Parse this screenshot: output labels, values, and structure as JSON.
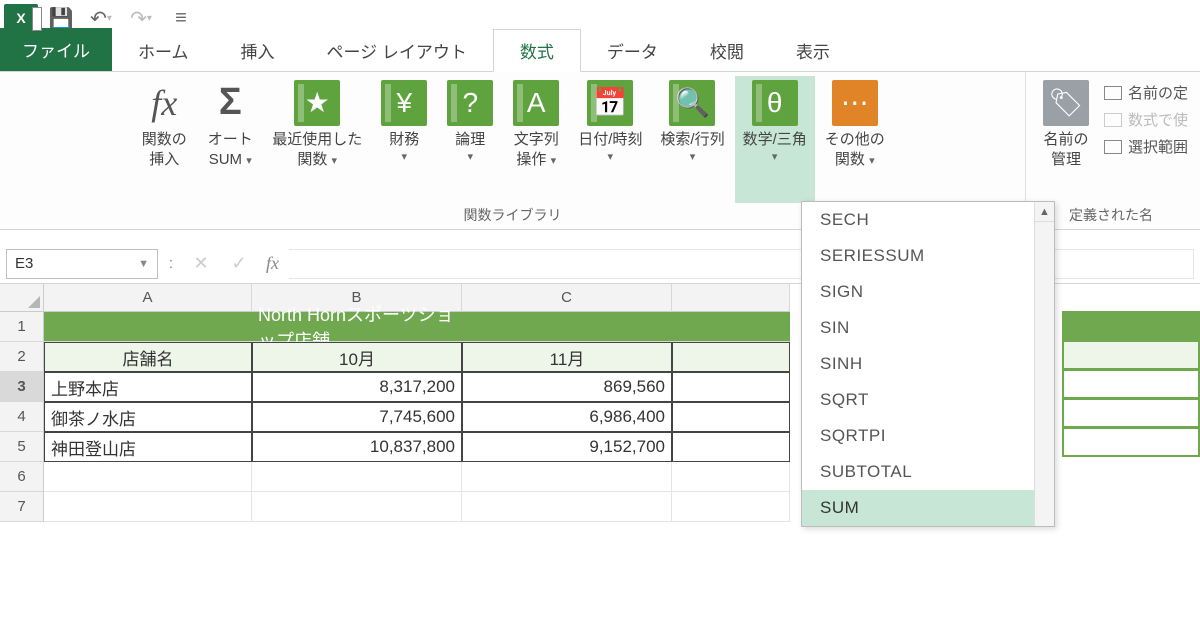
{
  "qat": {
    "undo_glyph": "↶",
    "redo_glyph": "↷",
    "dd_glyph": "▾"
  },
  "tabs": {
    "file": "ファイル",
    "items": [
      "ホーム",
      "挿入",
      "ページ レイアウト",
      "数式",
      "データ",
      "校閲",
      "表示"
    ],
    "active_index": 3
  },
  "ribbon": {
    "insert_fn": {
      "glyph": "fx",
      "label1": "関数の",
      "label2": "挿入"
    },
    "autosum": {
      "glyph": "Σ",
      "label1": "オート",
      "label2": "SUM",
      "dd": "▾"
    },
    "recent": {
      "glyph": "★",
      "label1": "最近使用した",
      "label2": "関数",
      "dd": "▾"
    },
    "financial": {
      "glyph": "¥",
      "label1": "財務",
      "dd": "▾"
    },
    "logical": {
      "glyph": "?",
      "label1": "論理",
      "dd": "▾"
    },
    "text": {
      "glyph": "A",
      "label1": "文字列",
      "label2": "操作",
      "dd": "▾"
    },
    "datetime": {
      "glyph": "📅",
      "label1": "日付/時刻",
      "dd": "▾"
    },
    "lookup": {
      "glyph": "🔍",
      "label1": "検索/行列",
      "dd": "▾"
    },
    "math": {
      "glyph": "θ",
      "label1": "数学/三角",
      "dd": "▾"
    },
    "more": {
      "glyph": "⋯",
      "label1": "その他の",
      "label2": "関数",
      "dd": "▾"
    },
    "group_label": "関数ライブラリ",
    "name_mgr": {
      "label1": "名前の",
      "label2": "管理"
    },
    "side": {
      "define": "名前の定",
      "use": "数式で使",
      "select": "選択範囲",
      "group_partial": "定義された名"
    }
  },
  "func_dropdown": {
    "items": [
      "SECH",
      "SERIESSUM",
      "SIGN",
      "SIN",
      "SINH",
      "SQRT",
      "SQRTPI",
      "SUBTOTAL",
      "SUM"
    ],
    "highlight_index": 8,
    "up": "▲"
  },
  "formula_bar": {
    "cell_ref": "E3",
    "fx_glyph": "fx",
    "cancel": "✕",
    "enter": "✓",
    "sep": ":"
  },
  "grid": {
    "cols": [
      "A",
      "B",
      "C"
    ],
    "row_nums": [
      "1",
      "2",
      "3",
      "4",
      "5",
      "6",
      "7"
    ],
    "selected_row": 3,
    "title": "North Hornスポーツショップ店舗",
    "headers": {
      "name": "店舗名",
      "m1": "10月",
      "m2": "11月"
    },
    "rows": [
      {
        "name": "上野本店",
        "m1": "8,317,200",
        "m2": "869,560"
      },
      {
        "name": "御茶ノ水店",
        "m1": "7,745,600",
        "m2": "6,986,400"
      },
      {
        "name": "神田登山店",
        "m1": "10,837,800",
        "m2": "9,152,700"
      }
    ]
  }
}
